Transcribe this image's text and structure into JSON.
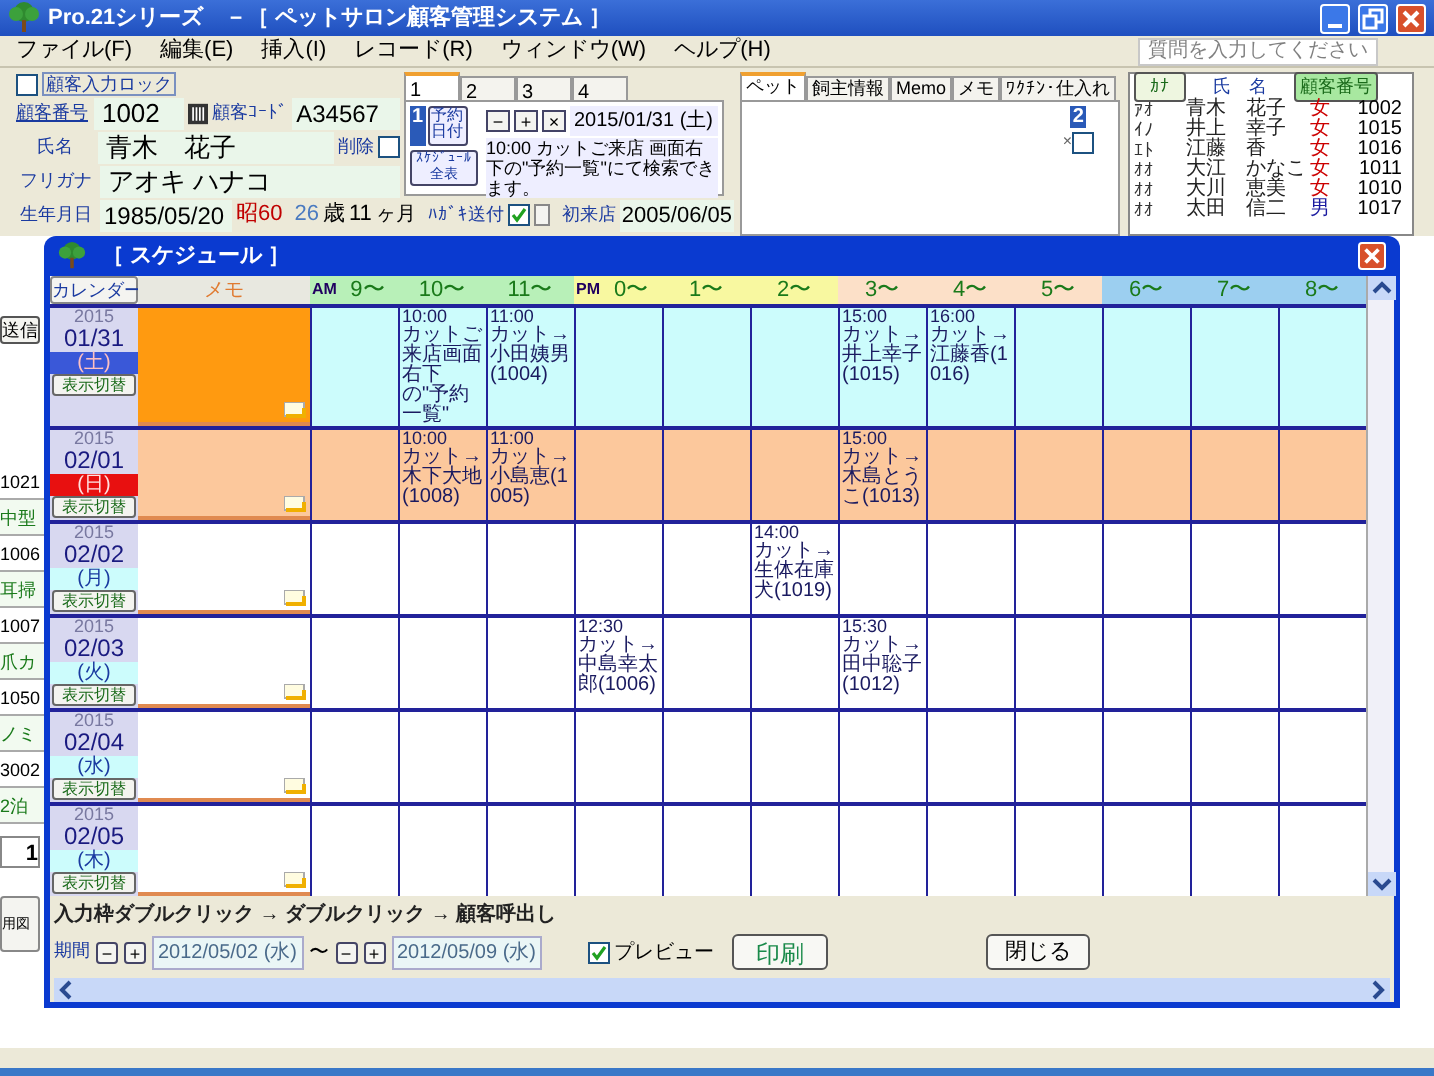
{
  "window": {
    "title": "Pro.21シリーズ　－［ ペットサロン顧客管理システム ］"
  },
  "menu": [
    "ファイル(F)",
    "編集(E)",
    "挿入(I)",
    "レコード(R)",
    "ウィンドウ(W)",
    "ヘルプ(H)"
  ],
  "help_search": {
    "placeholder": "質問を入力してください"
  },
  "customer_form": {
    "lock": {
      "label": "顧客入力ロック",
      "checked": false
    },
    "number_label": "顧客番号",
    "number": "1002",
    "code_label": "顧客ｺｰﾄﾞ",
    "code": "A34567",
    "name_label": "氏名",
    "name": "青木　花子",
    "delete": {
      "label": "削除",
      "checked": false
    },
    "kana_label": "フリガナ",
    "kana": "アオキ ハナコ",
    "birth_label": "生年月日",
    "birth": "1985/05/20",
    "era": "昭60",
    "age_years": "26",
    "age_unit": "歳",
    "age_months": "11",
    "month_unit": "ヶ月",
    "postcard": {
      "label": "ﾊｶﾞｷ送付",
      "checked": true
    },
    "first_visit_label": "初来店",
    "first_visit": "2005/06/05"
  },
  "reservation": {
    "tabs": [
      {
        "label": "1",
        "selected": true
      },
      {
        "label": "2",
        "selected": false
      },
      {
        "label": "3",
        "selected": false
      },
      {
        "label": "4",
        "selected": false
      }
    ],
    "badge": "1",
    "date_button": "予約日付",
    "buttons": [
      "−",
      "+",
      "×"
    ],
    "date": "2015/01/31 (土)",
    "note": "10:00 カットご来店 画面右下の\"予約一覧\"にて検索できます。",
    "schedule_button": "ｽｹｼﾞｭｰﾙ全表"
  },
  "pet_panel": {
    "tabs": [
      {
        "label": "ペット",
        "selected": true
      },
      {
        "label": "飼主情報",
        "selected": false
      },
      {
        "label": "Memo",
        "selected": false
      },
      {
        "label": "メモ",
        "selected": false
      },
      {
        "label": "ﾜｸﾁﾝ･仕入れ",
        "selected": false
      }
    ],
    "badge": "2",
    "remove": {
      "label": "×",
      "checked": false
    }
  },
  "customer_list": {
    "columns": [
      "ｶﾅ",
      "氏　名",
      "顧客番号"
    ],
    "rows": [
      {
        "kana": "ｱｵ",
        "name": "青木　花子",
        "sex": "女",
        "color": "#cc0000",
        "number": "1002"
      },
      {
        "kana": "ｲﾉ",
        "name": "井上　幸子",
        "sex": "女",
        "color": "#cc0000",
        "number": "1015"
      },
      {
        "kana": "ｴﾄ",
        "name": "江藤　香",
        "sex": "女",
        "color": "#cc0000",
        "number": "1016"
      },
      {
        "kana": "ｵｵ",
        "name": "大江　かなこ",
        "sex": "女",
        "color": "#cc0000",
        "number": "1011"
      },
      {
        "kana": "ｵｵ",
        "name": "大川　恵美",
        "sex": "女",
        "color": "#cc0000",
        "number": "1010"
      },
      {
        "kana": "ｵｵ",
        "name": "太田　信二",
        "sex": "男",
        "color": "#1a1aa0",
        "number": "1017"
      }
    ]
  },
  "background": {
    "send_button": "送信",
    "cells": [
      "1021",
      "中型",
      "1006",
      "耳掃",
      "1007",
      "爪カ",
      "1050",
      "ノミ",
      "3002",
      "2泊"
    ],
    "count": "1",
    "side_button": "用図"
  },
  "schedule": {
    "title": "［ スケジュール ］",
    "calendar_button": "カレンダー",
    "memo_header": "メモ",
    "hours": [
      {
        "label": "9〜",
        "prefix": "AM",
        "color": "#b8f0b8"
      },
      {
        "label": "10〜",
        "color": "#b8f0b8"
      },
      {
        "label": "11〜",
        "color": "#b8f0b8"
      },
      {
        "label": "0〜",
        "prefix": "PM",
        "color": "#f8f8a0"
      },
      {
        "label": "1〜",
        "color": "#f8f8a0"
      },
      {
        "label": "2〜",
        "color": "#f8f8a0"
      },
      {
        "label": "3〜",
        "color": "#fce0c8"
      },
      {
        "label": "4〜",
        "color": "#fce0c8"
      },
      {
        "label": "5〜",
        "color": "#fce0c8"
      },
      {
        "label": "6〜",
        "color": "#9ccff0"
      },
      {
        "label": "7〜",
        "color": "#9ccff0"
      },
      {
        "label": "8〜",
        "color": "#9ccff0"
      }
    ],
    "days": [
      {
        "year": "2015",
        "date": "01/31",
        "weekday": "(土)",
        "kind": "today",
        "toggle": "表示切替",
        "cells": [
          {},
          {
            "time": "10:00",
            "text": "カットご来店画面右下の\"予約一覧\""
          },
          {
            "time": "11:00",
            "text": "カット→小田姨男(1004)"
          },
          {},
          {},
          {},
          {
            "time": "15:00",
            "text": "カット→井上幸子(1015)"
          },
          {
            "time": "16:00",
            "text": "カット→江藤香(1016)"
          },
          {},
          {},
          {},
          {}
        ]
      },
      {
        "year": "2015",
        "date": "02/01",
        "weekday": "(日)",
        "kind": "holiday",
        "toggle": "表示切替",
        "cells": [
          {},
          {
            "time": "10:00",
            "text": "カット→木下大地(1008)"
          },
          {
            "time": "11:00",
            "text": "カット→小島恵(1005)"
          },
          {},
          {},
          {},
          {
            "time": "15:00",
            "text": "カット→木島とうこ(1013)"
          },
          {},
          {},
          {},
          {},
          {}
        ]
      },
      {
        "year": "2015",
        "date": "02/02",
        "weekday": "(月)",
        "kind": "normal",
        "toggle": "表示切替",
        "cells": [
          {},
          {},
          {},
          {},
          {},
          {
            "time": "14:00",
            "text": "カット→生体在庫犬(1019)"
          },
          {},
          {},
          {},
          {},
          {},
          {}
        ]
      },
      {
        "year": "2015",
        "date": "02/03",
        "weekday": "(火)",
        "kind": "normal",
        "toggle": "表示切替",
        "cells": [
          {},
          {},
          {},
          {
            "time": "12:30",
            "text": "カット→中島幸太郎(1006)"
          },
          {},
          {},
          {
            "time": "15:30",
            "text": "カット→田中聡子(1012)"
          },
          {},
          {},
          {},
          {},
          {}
        ]
      },
      {
        "year": "2015",
        "date": "02/04",
        "weekday": "(水)",
        "kind": "normal",
        "toggle": "表示切替",
        "cells": [
          {},
          {},
          {},
          {},
          {},
          {},
          {},
          {},
          {},
          {},
          {},
          {}
        ]
      },
      {
        "year": "2015",
        "date": "02/05",
        "weekday": "(木)",
        "kind": "normal",
        "toggle": "表示切替",
        "cells": [
          {},
          {},
          {},
          {},
          {},
          {},
          {},
          {},
          {},
          {},
          {},
          {}
        ]
      }
    ],
    "hint": "入力枠ダブルクリック → ダブルクリック → 顧客呼出し",
    "period_label": "期間",
    "from": "2012/05/02 (水)",
    "tilde": "〜",
    "to": "2012/05/09 (水)",
    "step_buttons": [
      "−",
      "+"
    ],
    "preview": {
      "label": "プレビュー",
      "checked": true
    },
    "print_button": "印刷",
    "close_button": "閉じる"
  }
}
